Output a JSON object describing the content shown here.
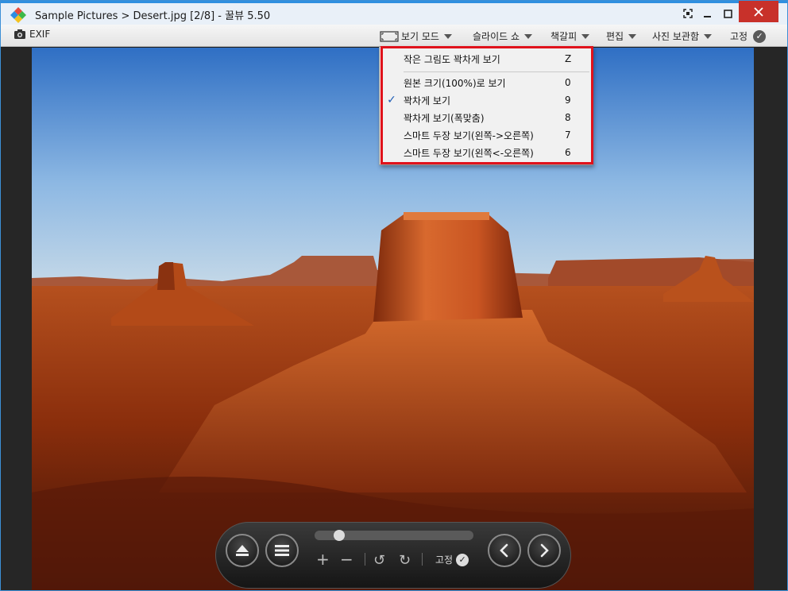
{
  "window": {
    "title": "Sample Pictures > Desert.jpg [2/8] - 꿀뷰 5.50",
    "colors": {
      "accent": "#2f8fe0",
      "close": "#c8312a",
      "highlight": "#e0121b"
    }
  },
  "toolbar": {
    "exif_label": "EXIF",
    "view_mode_label": "보기 모드",
    "slideshow_label": "슬라이드 쇼",
    "bookmark_label": "책갈피",
    "edit_label": "편집",
    "album_label": "사진 보관함",
    "pin_label": "고정"
  },
  "menu": {
    "items": [
      {
        "label": "작은 그림도 꽉차게 보기",
        "key": "Z",
        "checked": false
      },
      {
        "label": "원본 크기(100%)로 보기",
        "key": "0",
        "checked": false
      },
      {
        "label": "꽉차게 보기",
        "key": "9",
        "checked": true
      },
      {
        "label": "꽉차게 보기(폭맞춤)",
        "key": "8",
        "checked": false
      },
      {
        "label": "스마트 두장 보기(왼쪽->오른쪽)",
        "key": "7",
        "checked": false
      },
      {
        "label": "스마트 두장 보기(왼쪽<-오른쪽)",
        "key": "6",
        "checked": false
      }
    ],
    "check_mark": "✓"
  },
  "controls": {
    "pin_label": "고정"
  }
}
